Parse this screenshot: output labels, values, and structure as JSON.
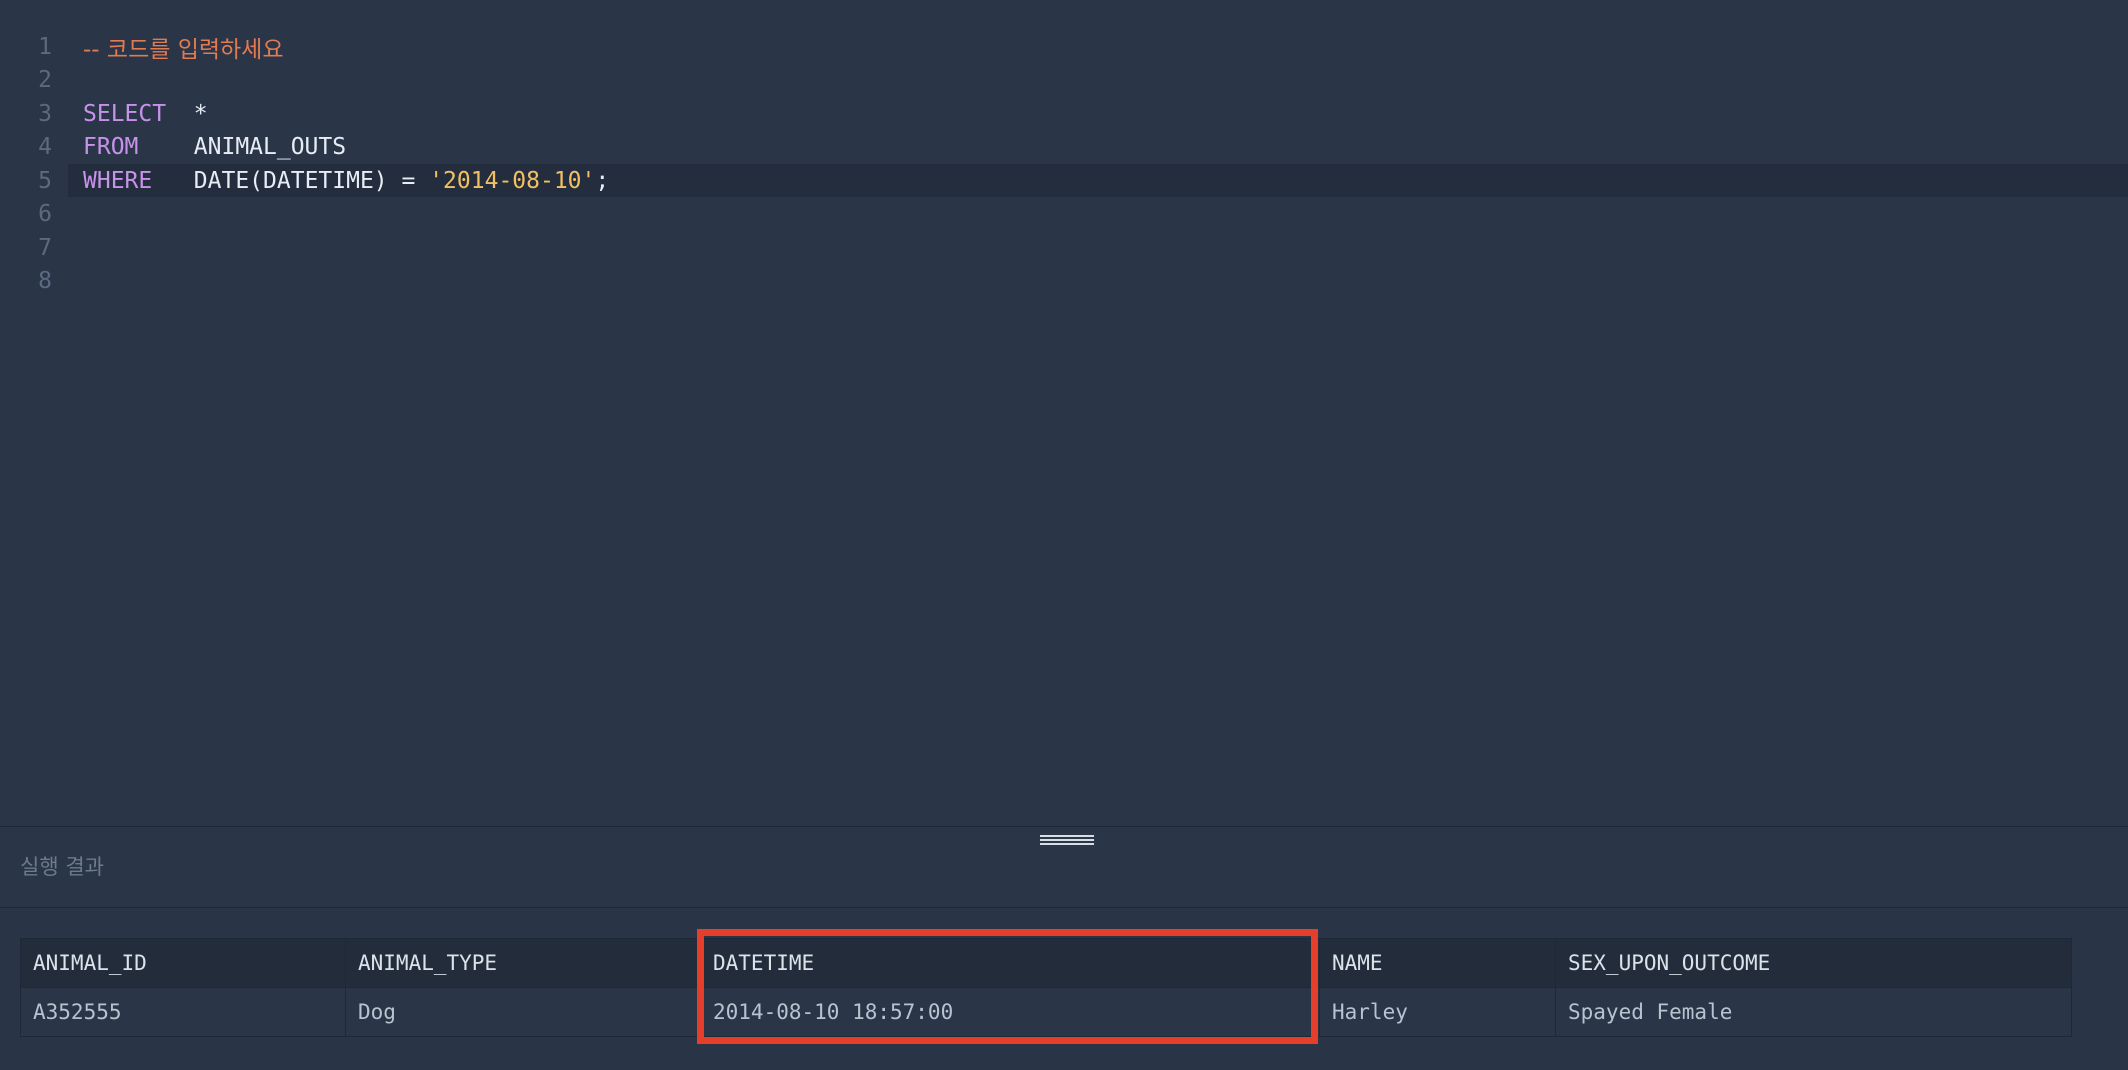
{
  "editor": {
    "lines": [
      {
        "num": "1",
        "tokens": [
          {
            "t": "-- 코드를 입력하세요",
            "k": "comment"
          }
        ]
      },
      {
        "num": "2",
        "tokens": []
      },
      {
        "num": "3",
        "tokens": [
          {
            "t": "SELECT",
            "k": "keyword"
          },
          {
            "t": "  *",
            "k": "plain"
          }
        ]
      },
      {
        "num": "4",
        "tokens": [
          {
            "t": "FROM",
            "k": "keyword"
          },
          {
            "t": "    ANIMAL_OUTS",
            "k": "plain"
          }
        ]
      },
      {
        "num": "5",
        "tokens": [
          {
            "t": "WHERE",
            "k": "keyword"
          },
          {
            "t": "   DATE(DATETIME) = ",
            "k": "plain"
          },
          {
            "t": "'2014-08-10'",
            "k": "string"
          },
          {
            "t": ";",
            "k": "plain"
          }
        ],
        "active": true
      },
      {
        "num": "6",
        "tokens": []
      },
      {
        "num": "7",
        "tokens": []
      },
      {
        "num": "8",
        "tokens": []
      }
    ]
  },
  "results": {
    "title": "실행 결과",
    "columns": [
      "ANIMAL_ID",
      "ANIMAL_TYPE",
      "DATETIME",
      "NAME",
      "SEX_UPON_OUTCOME"
    ],
    "rows": [
      [
        "A352555",
        "Dog",
        "2014-08-10 18:57:00",
        "Harley",
        "Spayed Female"
      ]
    ]
  },
  "colors": {
    "keyword": "#c792ea",
    "comment": "#e07b53",
    "string": "#f2c063",
    "highlight": "#e53e2b"
  }
}
